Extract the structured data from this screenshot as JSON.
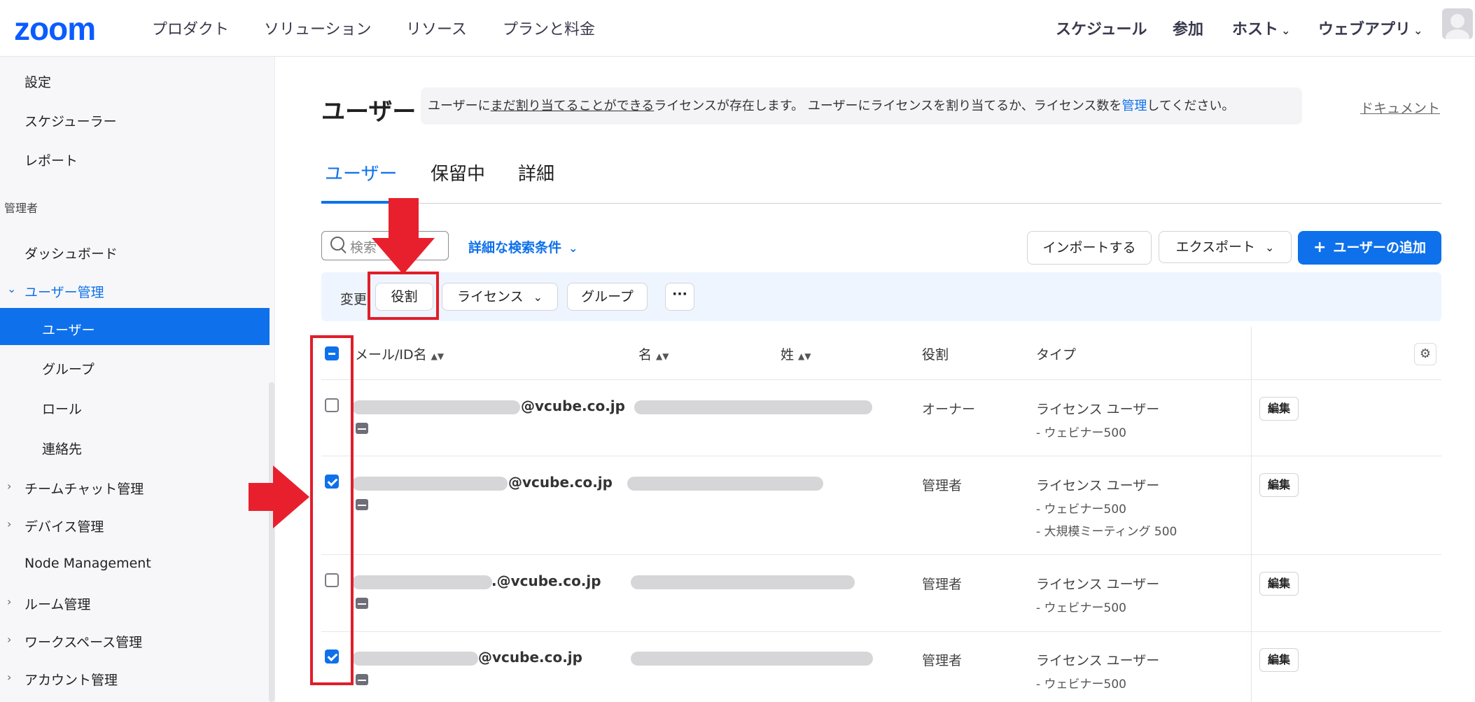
{
  "nav": {
    "logo": "zoom",
    "left_items": [
      "プロダクト",
      "ソリューション",
      "リソース",
      "プランと料金"
    ],
    "right_items": [
      "スケジュール",
      "参加",
      "ホスト",
      "ウェブアプリ"
    ]
  },
  "sidebar": {
    "items_top": [
      "設定",
      "スケジューラー",
      "レポート"
    ],
    "section_admin": "管理者",
    "dashboard": "ダッシュボード",
    "user_mgmt": "ユーザー管理",
    "sub_items": [
      "ユーザー",
      "グループ",
      "ロール",
      "連絡先"
    ],
    "collapsed": [
      "チームチャット管理",
      "デバイス管理"
    ],
    "node": "Node Management",
    "collapsed2": [
      "ルーム管理",
      "ワークスペース管理",
      "アカウント管理"
    ]
  },
  "page": {
    "title": "ユーザー",
    "notice_pre": "ユーザーに",
    "notice_link": "まだ割り当てることができる",
    "notice_mid": "ライセンスが存在します。 ユーザーにライセンスを割り当てるか、ライセンス数を",
    "notice_manage": "管理",
    "notice_post": "してください。",
    "docs": "ドキュメント",
    "tabs": [
      "ユーザー",
      "保留中",
      "詳細"
    ]
  },
  "toolbar": {
    "search_placeholder": "検索",
    "advanced_search": "詳細な検索条件",
    "import": "インポートする",
    "export": "エクスポート",
    "add_user": "ユーザーの追加",
    "bulk_label": "変更",
    "role": "役割",
    "license": "ライセンス",
    "group": "グループ",
    "more": "···"
  },
  "table": {
    "headers": [
      "メール/ID名",
      "名",
      "姓",
      "役割",
      "タイプ"
    ],
    "edit_label": "編集",
    "rows": [
      {
        "email": "@vcube.co.jp",
        "role": "オーナー",
        "type": "ライセンス ユーザー",
        "subs": [
          "- ウェビナー500"
        ],
        "checked": false
      },
      {
        "email": "@vcube.co.jp",
        "role": "管理者",
        "type": "ライセンス ユーザー",
        "subs": [
          "- ウェビナー500",
          "- 大規模ミーティング 500"
        ],
        "checked": true
      },
      {
        "email": ".@vcube.co.jp",
        "role": "管理者",
        "type": "ライセンス ユーザー",
        "subs": [
          "- ウェビナー500"
        ],
        "checked": false
      },
      {
        "email": "@vcube.co.jp",
        "role": "管理者",
        "type": "ライセンス ユーザー",
        "subs": [
          "- ウェビナー500"
        ],
        "checked": true
      }
    ]
  },
  "colors": {
    "accent": "#0e71eb",
    "annotation_red": "#e11d2a"
  }
}
